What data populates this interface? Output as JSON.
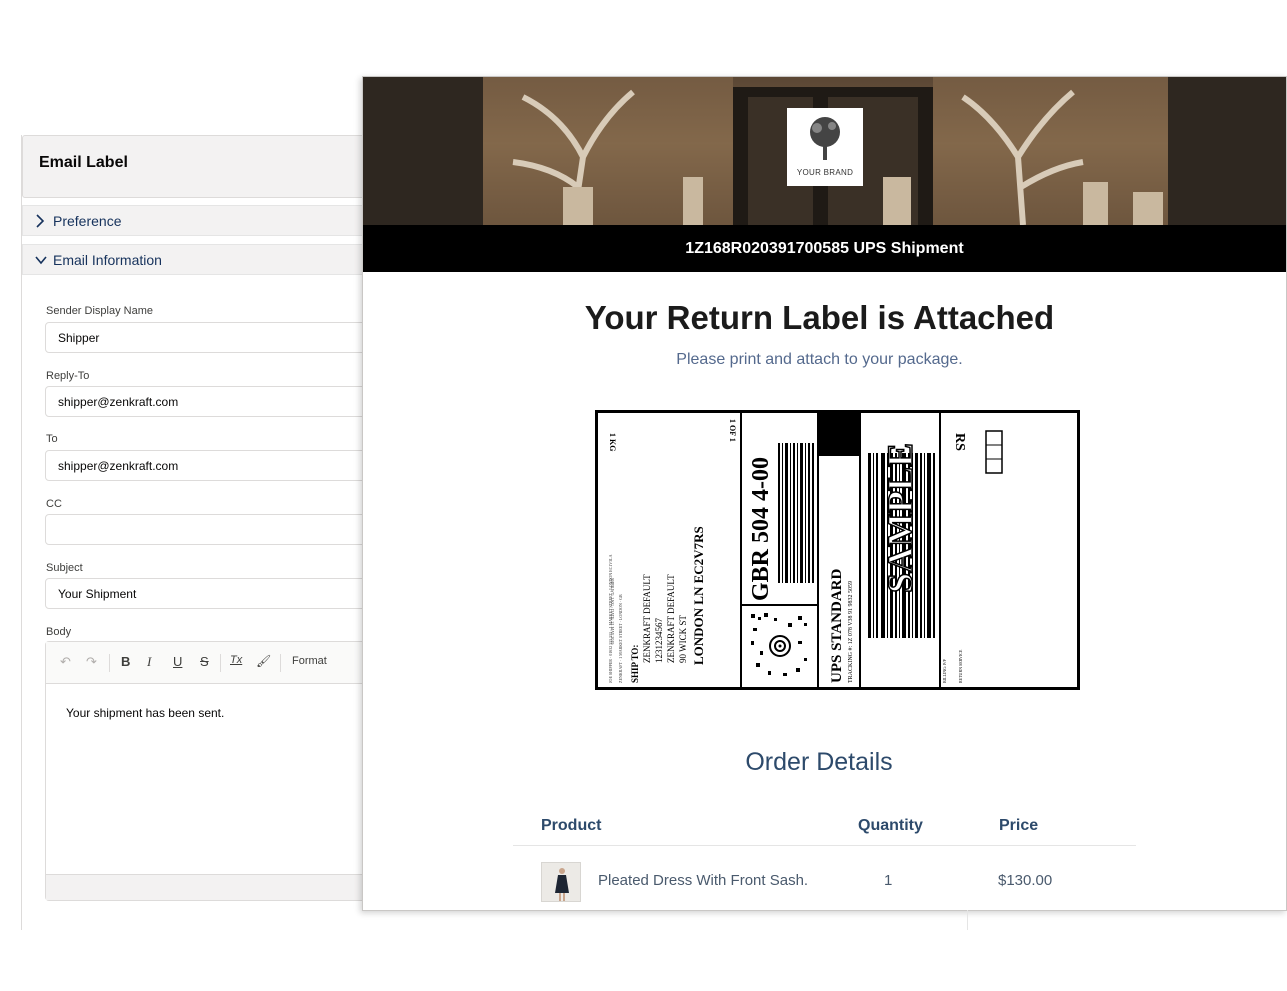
{
  "email_form": {
    "card_title": "Email Label",
    "sections": {
      "preference": "Preference",
      "email_information": "Email Information"
    },
    "fields": {
      "sender_display_name": {
        "label": "Sender Display Name",
        "value": "Shipper"
      },
      "reply_to": {
        "label": "Reply-To",
        "value": "shipper@zenkraft.com"
      },
      "to": {
        "label": "To",
        "value": "shipper@zenkraft.com"
      },
      "cc": {
        "label": "CC",
        "value": ""
      },
      "subject": {
        "label": "Subject",
        "value": "Your Shipment"
      },
      "body": {
        "label": "Body",
        "value": "Your shipment has been sent."
      }
    },
    "toolbar": {
      "undo": "↶",
      "redo": "↷",
      "bold": "B",
      "italic": "I",
      "underline": "U",
      "strike": "S",
      "clear": "Tx",
      "paint": "🖌",
      "format_label": "Format"
    }
  },
  "preview": {
    "brand_text": "YOUR BRAND",
    "tracking_header": "1Z168R020391700585 UPS Shipment",
    "headline": "Your Return Label is Attached",
    "subline": "Please print and attach to your package.",
    "label": {
      "weight": "1 KG",
      "count": "1 OF 1",
      "ship_to": "SHIP TO:",
      "recipient_lines": [
        "ZENKRAFT DEFAULT",
        "1231234567",
        "ZENKRAFT DEFAULT",
        "90 WICK ST"
      ],
      "city": "LONDON  LN EC2V7RS",
      "routing": "GBR 504 4-00",
      "service": "UPS STANDARD",
      "tracking": "TRACKING #: 1Z 078 V38 91 9832 5059",
      "watermark": "SAMPLE",
      "rs": "RS",
      "billing": "BILLING: P/P",
      "return_service": "RETURN SERVICE"
    },
    "order_title": "Order Details",
    "table": {
      "headers": [
        "Product",
        "Quantity",
        "Price"
      ],
      "rows": [
        {
          "product": "Pleated Dress With Front Sash.",
          "quantity": "1",
          "price": "$130.00"
        }
      ]
    }
  }
}
